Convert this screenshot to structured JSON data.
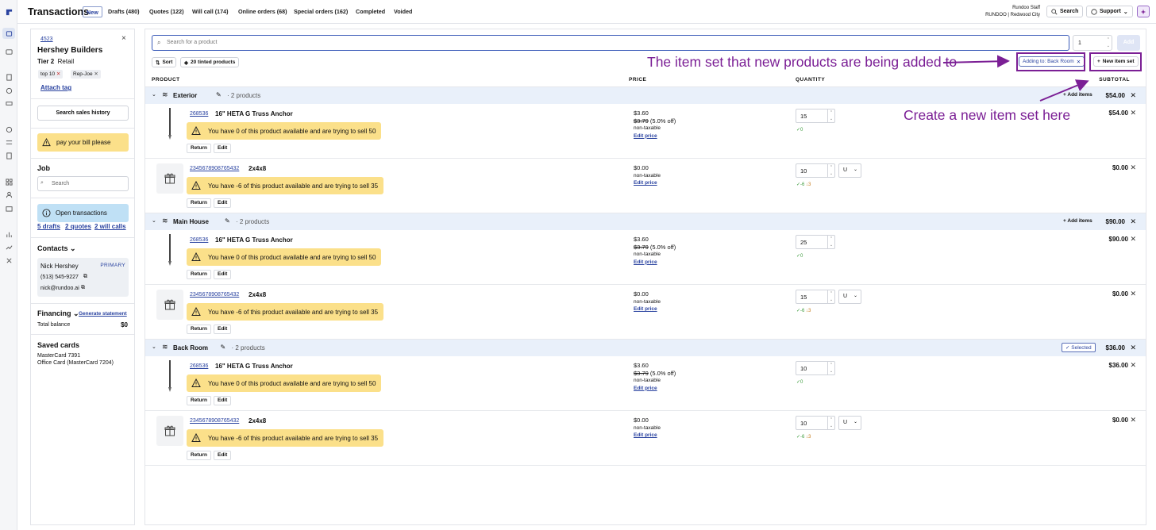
{
  "app": {
    "title": "Transactions"
  },
  "tabs": [
    {
      "label": "New"
    },
    {
      "label": "Drafts (480)"
    },
    {
      "label": "Quotes (122)"
    },
    {
      "label": "Will call (174)"
    },
    {
      "label": "Online orders (68)"
    },
    {
      "label": "Special orders (162)"
    },
    {
      "label": "Completed"
    },
    {
      "label": "Voided"
    }
  ],
  "user": {
    "name": "Rundoo Staff",
    "location": "RUNDOO | Redwood City"
  },
  "topbar": {
    "search_label": "Search",
    "support_label": "Support"
  },
  "customer": {
    "id": "4523",
    "name": "Hershey Builders",
    "tier": "Tier 2",
    "type": "Retail",
    "tags": [
      "top 10",
      "Rep-Joe"
    ],
    "attach_tag": "Attach tag",
    "sales_history": "Search sales history",
    "alert": "pay your bill please"
  },
  "job": {
    "heading": "Job",
    "placeholder": "Search"
  },
  "open_transactions": {
    "label": "Open transactions",
    "drafts": "5 drafts",
    "quotes": "2 quotes",
    "will_calls": "2 will calls"
  },
  "contacts": {
    "heading": "Contacts",
    "name": "Nick Hershey",
    "badge": "PRIMARY",
    "phone": "(513) 545-9227",
    "email": "nick@rundoo.ai"
  },
  "financing": {
    "heading": "Financing",
    "link": "Generate statement",
    "balance_label": "Total balance",
    "balance_value": "$0"
  },
  "saved_cards": {
    "heading": "Saved cards",
    "cards": [
      "MasterCard 7391",
      "Office Card (MasterCard 7204)"
    ]
  },
  "product_search": {
    "placeholder": "Search for a product",
    "qty": "1",
    "add_label": "Add"
  },
  "toolbar": {
    "sort": "Sort",
    "tinted": "20 tinted products",
    "adding_to": "Adding to: Back Room",
    "new_item_set": "New item set"
  },
  "columns": {
    "product": "PRODUCT",
    "price": "PRICE",
    "quantity": "QUANTITY",
    "subtotal": "SUBTOTAL"
  },
  "labels": {
    "return": "Return",
    "edit": "Edit",
    "edit_price": "Edit price",
    "add_items": "Add items",
    "selected": "Selected",
    "non_taxable": "non-taxable",
    "unit": "U"
  },
  "groups": [
    {
      "name": "Exterior",
      "count": "· 2 products",
      "subtotal": "$54.00",
      "items": [
        {
          "sku": "268536",
          "name": "16\" HETA G Truss Anchor",
          "warning": "You have 0 of this product available and are trying to sell 50",
          "price": "$3.60",
          "orig_price": "$3.79",
          "discount": "(5.0% off)",
          "qty": "15",
          "avail": [
            "✓0"
          ],
          "subtotal": "$54.00"
        },
        {
          "sku": "2345678908765432",
          "name": "2x4x8",
          "warning": "You have -6 of this product available and are trying to sell 35",
          "price": "$0.00",
          "qty": "10",
          "avail": [
            "✓-6",
            "↓3"
          ],
          "subtotal": "$0.00"
        }
      ]
    },
    {
      "name": "Main House",
      "count": "· 2 products",
      "subtotal": "$90.00",
      "items": [
        {
          "sku": "268536",
          "name": "16\" HETA G Truss Anchor",
          "warning": "You have 0 of this product available and are trying to sell 50",
          "price": "$3.60",
          "orig_price": "$3.79",
          "discount": "(5.0% off)",
          "qty": "25",
          "avail": [
            "✓0"
          ],
          "subtotal": "$90.00"
        },
        {
          "sku": "2345678908765432",
          "name": "2x4x8",
          "warning": "You have -6 of this product available and are trying to sell 35",
          "price": "$0.00",
          "qty": "15",
          "avail": [
            "✓-6",
            "↓3"
          ],
          "subtotal": "$0.00"
        }
      ]
    },
    {
      "name": "Back Room",
      "count": "· 2 products",
      "subtotal": "$36.00",
      "items": [
        {
          "sku": "268536",
          "name": "16\" HETA G Truss Anchor",
          "warning": "You have 0 of this product available and are trying to sell 50",
          "price": "$3.60",
          "orig_price": "$3.79",
          "discount": "(5.0% off)",
          "qty": "10",
          "avail": [
            "✓0"
          ],
          "subtotal": "$36.00"
        },
        {
          "sku": "2345678908765432",
          "name": "2x4x8",
          "warning": "You have -6 of this product available and are trying to sell 35",
          "price": "$0.00",
          "qty": "10",
          "avail": [
            "✓-6",
            "↓3"
          ],
          "subtotal": "$0.00"
        }
      ]
    }
  ],
  "annotations": {
    "item_set": "The item set that new products are being added to",
    "create_set": "Create a new item set here",
    "color": "#7b1f95"
  }
}
